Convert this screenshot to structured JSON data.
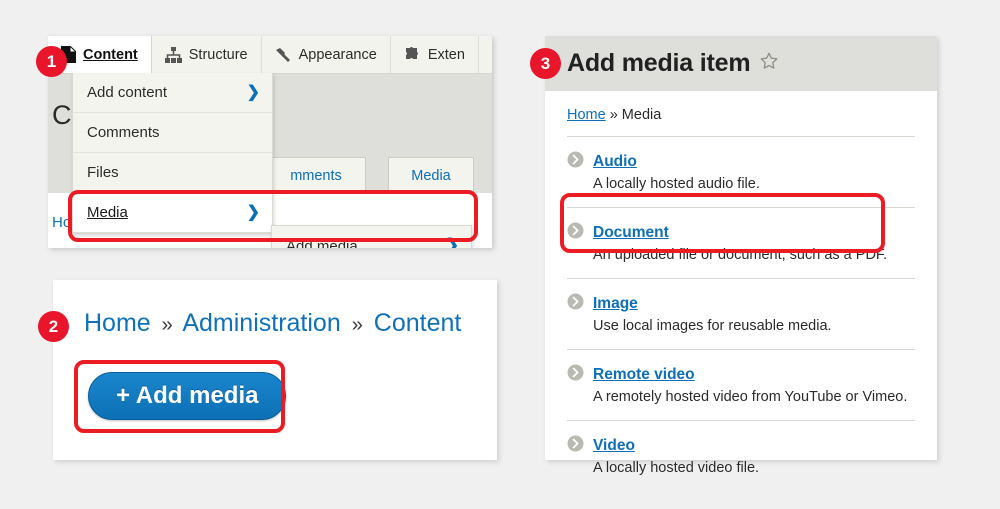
{
  "panel1": {
    "badge": "1",
    "toolbar": [
      {
        "label": "Content",
        "icon": "document-icon",
        "active": true
      },
      {
        "label": "Structure",
        "icon": "hierarchy-icon",
        "active": false
      },
      {
        "label": "Appearance",
        "icon": "paintbrush-icon",
        "active": false
      },
      {
        "label": "Exten",
        "icon": "puzzle-icon",
        "active": false
      }
    ],
    "page_heading": "Co",
    "tabs": [
      "mments",
      "Media"
    ],
    "home_link": "Ho",
    "menu_items": [
      {
        "label": "Add content",
        "arrow": "❯",
        "open": false
      },
      {
        "label": "Comments",
        "arrow": "",
        "open": false
      },
      {
        "label": "Files",
        "arrow": "",
        "open": false
      },
      {
        "label": "Media",
        "arrow": "❯",
        "open": true
      }
    ],
    "submenu_items": [
      {
        "label": "Add media",
        "arrow": "❯"
      }
    ]
  },
  "panel2": {
    "badge": "2",
    "breadcrumb": [
      {
        "text": "Home",
        "type": "link"
      },
      {
        "text": "»",
        "type": "sep"
      },
      {
        "text": "Administration",
        "type": "link"
      },
      {
        "text": "»",
        "type": "sep"
      },
      {
        "text": "Content",
        "type": "link"
      }
    ],
    "add_media_button": "+ Add media"
  },
  "panel3": {
    "badge": "3",
    "title": "Add media item",
    "star_icon": "star-outline-icon",
    "breadcrumb_link": "Home",
    "breadcrumb_rest": " » Media",
    "items": [
      {
        "title": "Audio",
        "desc": "A locally hosted audio file."
      },
      {
        "title": "Document",
        "desc": "An uploaded file or document, such as a PDF."
      },
      {
        "title": "Image",
        "desc": "Use local images for reusable media."
      },
      {
        "title": "Remote video",
        "desc": "A remotely hosted video from YouTube or Vimeo."
      },
      {
        "title": "Video",
        "desc": "A locally hosted video file."
      }
    ]
  },
  "colors": {
    "highlight_red": "#ec1c24",
    "badge_red": "#e8152b",
    "link_blue": "#0d6fb8",
    "button_blue": "#1279bf",
    "header_tan": "#dededa",
    "page_bg": "#f0f0f0"
  }
}
